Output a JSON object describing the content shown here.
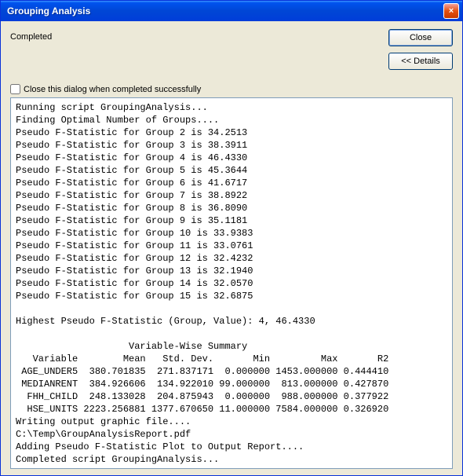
{
  "titlebar": {
    "title": "Grouping Analysis",
    "close_icon": "×"
  },
  "status": "Completed",
  "buttons": {
    "close": "Close",
    "details": "<< Details"
  },
  "checkbox": {
    "label": "Close this dialog when completed successfully",
    "checked": false
  },
  "log": {
    "lines": [
      "Running script GroupingAnalysis...",
      "Finding Optimal Number of Groups....",
      "Pseudo F-Statistic for Group 2 is 34.2513",
      "Pseudo F-Statistic for Group 3 is 38.3911",
      "Pseudo F-Statistic for Group 4 is 46.4330",
      "Pseudo F-Statistic for Group 5 is 45.3644",
      "Pseudo F-Statistic for Group 6 is 41.6717",
      "Pseudo F-Statistic for Group 7 is 38.8922",
      "Pseudo F-Statistic for Group 8 is 36.8090",
      "Pseudo F-Statistic for Group 9 is 35.1181",
      "Pseudo F-Statistic for Group 10 is 33.9383",
      "Pseudo F-Statistic for Group 11 is 33.0761",
      "Pseudo F-Statistic for Group 12 is 32.4232",
      "Pseudo F-Statistic for Group 13 is 32.1940",
      "Pseudo F-Statistic for Group 14 is 32.0570",
      "Pseudo F-Statistic for Group 15 is 32.6875",
      "",
      "Highest Pseudo F-Statistic (Group, Value): 4, 46.4330",
      "",
      "                    Variable-Wise Summary",
      "   Variable        Mean   Std. Dev.       Min         Max       R2",
      " AGE_UNDER5  380.701835  271.837171  0.000000 1453.000000 0.444410",
      " MEDIANRENT  384.926606  134.922010 99.000000  813.000000 0.427870",
      "  FHH_CHILD  248.133028  204.875943  0.000000  988.000000 0.377922",
      "  HSE_UNITS 2223.256881 1377.670650 11.000000 7584.000000 0.326920",
      "Writing output graphic file....",
      "C:\\Temp\\GroupAnalysisReport.pdf",
      "Adding Pseudo F-Statistic Plot to Output Report....",
      "Completed script GroupingAnalysis..."
    ]
  }
}
